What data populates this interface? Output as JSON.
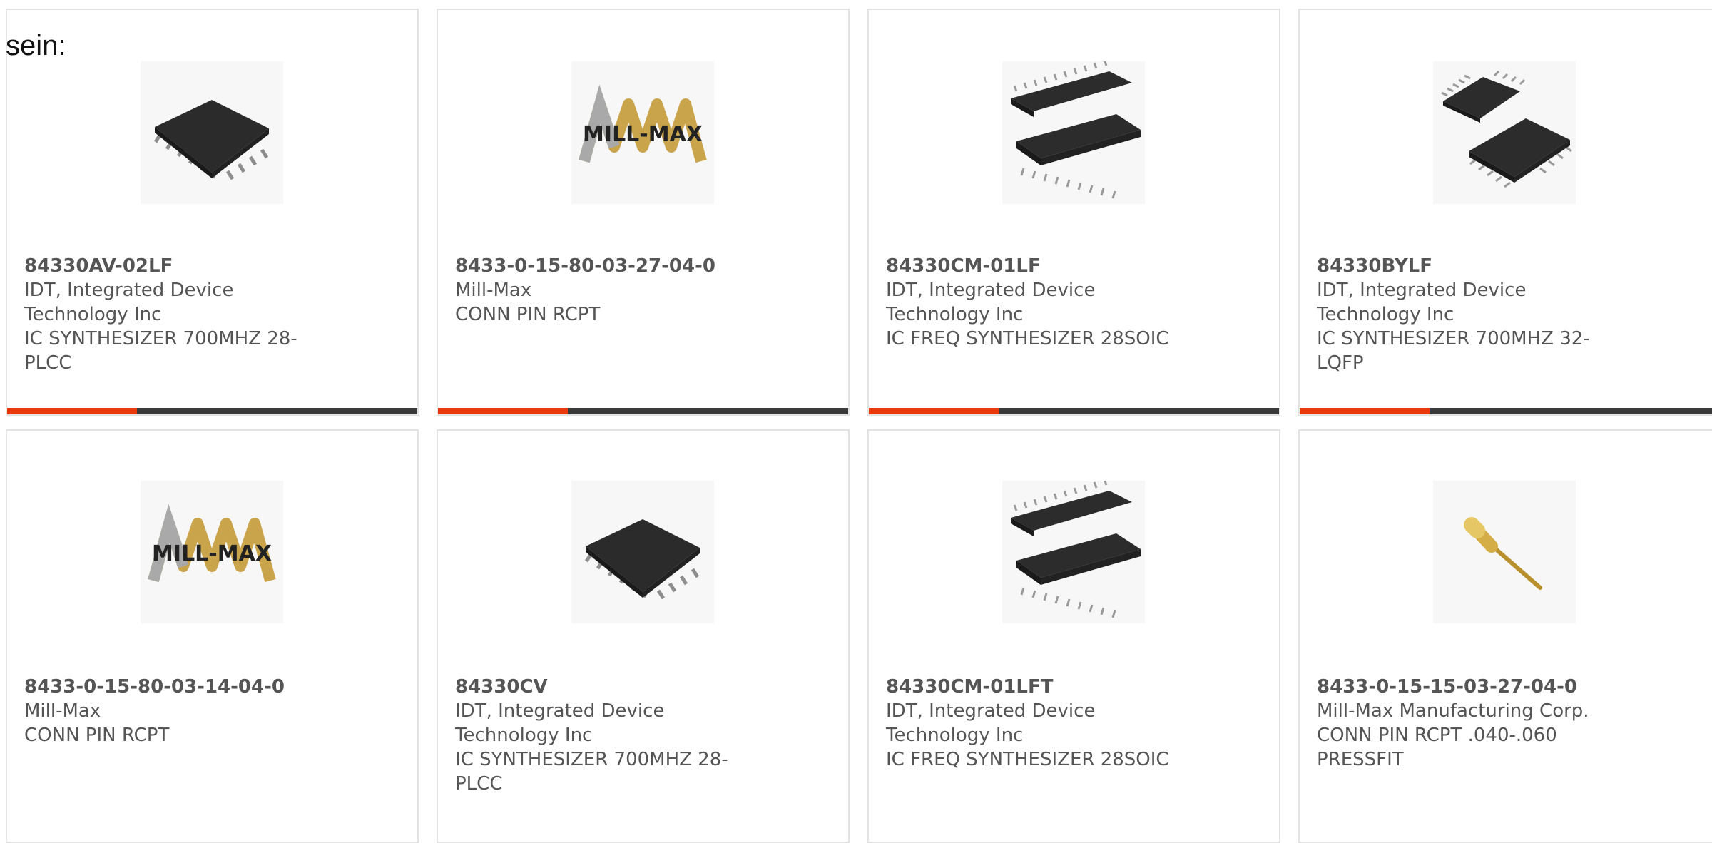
{
  "page": {
    "lead_text": "sein:"
  },
  "colors": {
    "accent_bar": "#e8390c",
    "dark_bar": "#3a3a3a",
    "text": "#555555",
    "card_border": "#e3e3e3"
  },
  "products": [
    {
      "part_number": "84330AV-02LF",
      "manufacturer": "IDT, Integrated Device Technology Inc",
      "description": "IC SYNTHESIZER 700MHZ 28-PLCC",
      "image": "plcc-chip-icon"
    },
    {
      "part_number": "8433-0-15-80-03-27-04-0",
      "manufacturer": "Mill-Max",
      "description": "CONN PIN RCPT",
      "image": "mill-max-logo"
    },
    {
      "part_number": "84330CM-01LF",
      "manufacturer": "IDT, Integrated Device Technology Inc",
      "description": "IC FREQ SYNTHESIZER 28SOIC",
      "image": "soic-chip-icon"
    },
    {
      "part_number": "84330BYLF",
      "manufacturer": "IDT, Integrated Device Technology Inc",
      "description": "IC SYNTHESIZER 700MHZ 32-LQFP",
      "image": "lqfp-chip-icon"
    },
    {
      "part_number": "8433-0-15-80-03-14-04-0",
      "manufacturer": "Mill-Max",
      "description": "CONN PIN RCPT",
      "image": "mill-max-logo"
    },
    {
      "part_number": "84330CV",
      "manufacturer": "IDT, Integrated Device Technology Inc",
      "description": "IC SYNTHESIZER 700MHZ 28-PLCC",
      "image": "plcc-chip-icon"
    },
    {
      "part_number": "84330CM-01LFT",
      "manufacturer": "IDT, Integrated Device Technology Inc",
      "description": "IC FREQ SYNTHESIZER 28SOIC",
      "image": "soic-chip-icon"
    },
    {
      "part_number": "8433-0-15-15-03-27-04-0",
      "manufacturer": "Mill-Max Manufacturing Corp.",
      "description": "CONN PIN RCPT .040-.060 PRESSFIT",
      "image": "pin-receptacle-icon"
    }
  ]
}
